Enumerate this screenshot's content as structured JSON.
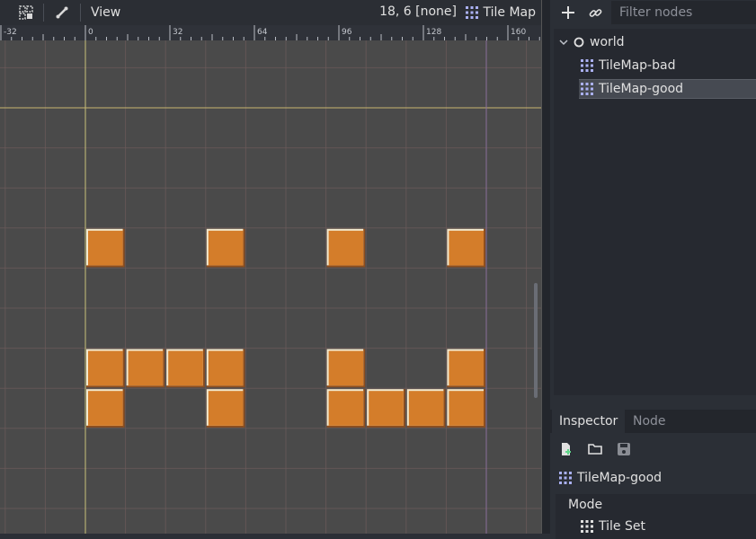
{
  "toolbar": {
    "view_menu": "View",
    "cursor_readout": "18, 6 [none]",
    "tilemap_menu": "Tile Map"
  },
  "ruler": {
    "labels": [
      "-32",
      "0",
      "32",
      "64",
      "96",
      "128",
      "160"
    ]
  },
  "canvas": {
    "cell_size": 32,
    "filled_cells": [
      [
        0,
        3
      ],
      [
        3,
        3
      ],
      [
        6,
        3
      ],
      [
        9,
        3
      ],
      [
        0,
        6
      ],
      [
        1,
        6
      ],
      [
        2,
        6
      ],
      [
        3,
        6
      ],
      [
        6,
        6
      ],
      [
        9,
        6
      ],
      [
        0,
        7
      ],
      [
        3,
        7
      ],
      [
        6,
        7
      ],
      [
        7,
        7
      ],
      [
        8,
        7
      ],
      [
        9,
        7
      ]
    ],
    "tile_color": "#d47d2a",
    "tile_highlight": "#f2ead0",
    "tile_shadow": "#8f4e1d"
  },
  "scene": {
    "filter_placeholder": "Filter nodes",
    "tree": {
      "root": "world",
      "children": [
        "TileMap-bad",
        "TileMap-good"
      ],
      "selected": "TileMap-good"
    }
  },
  "inspector": {
    "tabs": [
      "Inspector",
      "Node"
    ],
    "active_tab": "Inspector",
    "object_name": "TileMap-good",
    "properties": {
      "section": "Mode",
      "tile_set_label": "Tile Set"
    }
  }
}
